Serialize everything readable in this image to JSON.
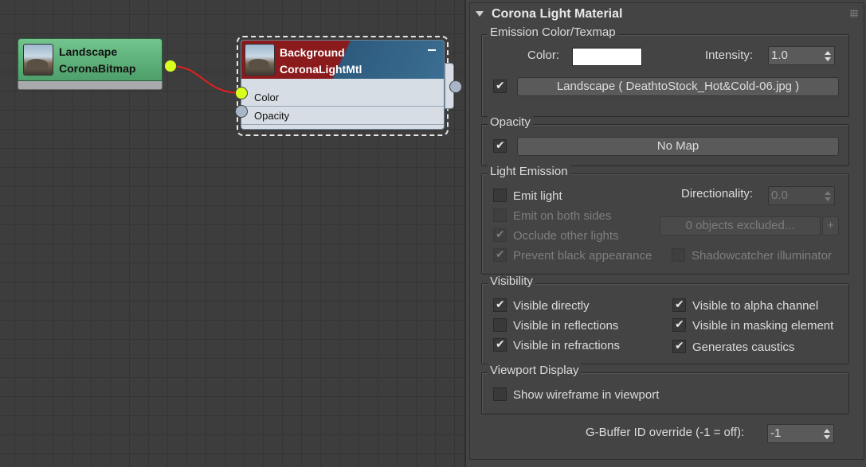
{
  "graph": {
    "bitmap_node": {
      "name": "Landscape",
      "type": "CoronaBitmap",
      "header_color": "#5fb27a"
    },
    "light_node": {
      "name": "Background",
      "type": "CoronaLightMtl",
      "slots": [
        "Color",
        "Opacity"
      ],
      "header_colors": [
        "#8a1a1c",
        "#2d5b7e"
      ]
    },
    "wire_color": "#e02020",
    "port_active_color": "#d8ff1e"
  },
  "panel": {
    "rollout_title": "Corona Light Material",
    "emission": {
      "group_label": "Emission Color/Texmap",
      "color_label": "Color:",
      "color_value": "#ffffff",
      "intensity_label": "Intensity:",
      "intensity_value": "1.0",
      "map_enabled": true,
      "map_button": "Landscape ( DeathtoStock_Hot&Cold-06.jpg )"
    },
    "opacity": {
      "group_label": "Opacity",
      "map_enabled": true,
      "map_button": "No Map"
    },
    "light_emission": {
      "group_label": "Light Emission",
      "emit_light": "Emit light",
      "emit_both_sides": "Emit on both sides",
      "occlude_other": "Occlude other lights",
      "prevent_black": "Prevent black appearance",
      "directionality_label": "Directionality:",
      "directionality_value": "0.0",
      "excluded_button": "0 objects excluded...",
      "add_button": "+",
      "shadowcatcher": "Shadowcatcher illuminator"
    },
    "visibility": {
      "group_label": "Visibility",
      "visible_directly": "Visible directly",
      "visible_reflections": "Visible in reflections",
      "visible_refractions": "Visible in refractions",
      "visible_alpha": "Visible to alpha channel",
      "visible_masking": "Visible in masking element",
      "generates_caustics": "Generates caustics"
    },
    "viewport": {
      "group_label": "Viewport Display",
      "show_wireframe": "Show wireframe in viewport"
    },
    "gbuffer": {
      "label": "G-Buffer ID override (-1 = off):",
      "value": "-1"
    }
  }
}
